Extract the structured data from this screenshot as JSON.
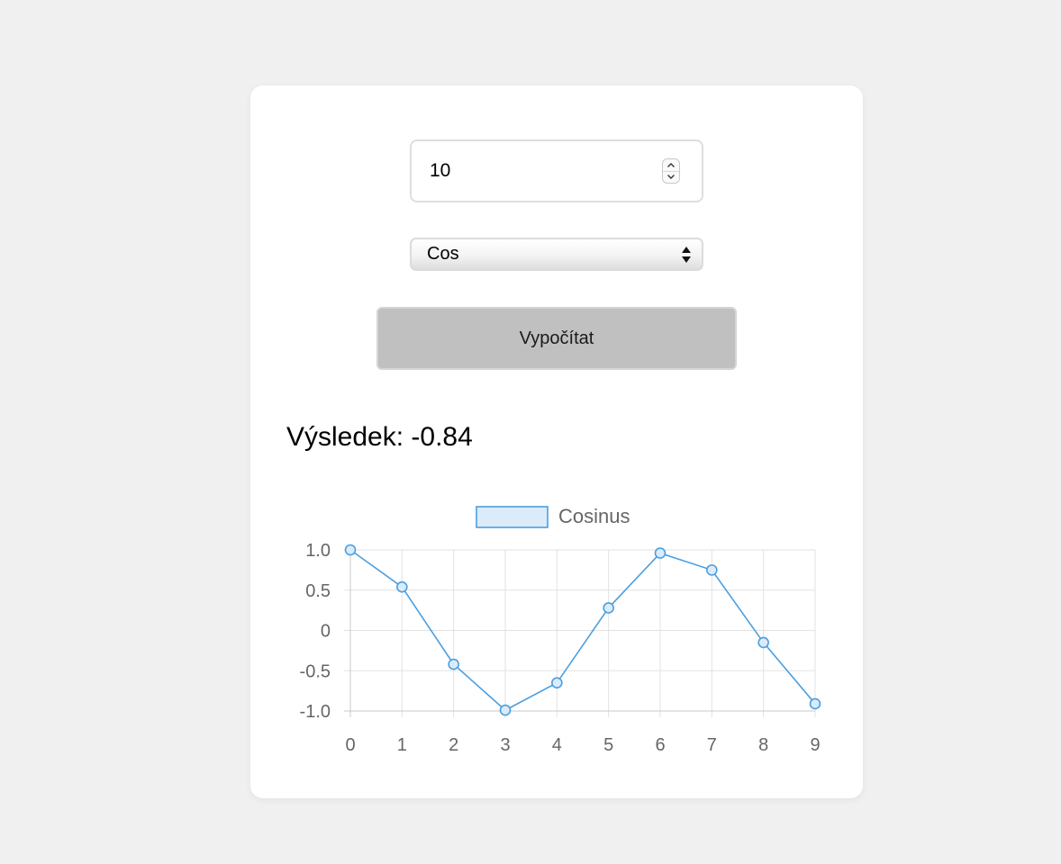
{
  "form": {
    "number_value": "10",
    "function_select": {
      "selected": "Cos"
    },
    "calculate_label": "Vypočítat"
  },
  "result": {
    "text": "Výsledek: -0.84"
  },
  "colors": {
    "page_background": "#f0f0f0",
    "card_background": "#ffffff",
    "button_background": "#c0c0c0",
    "series_line": "#4a9fe0",
    "series_fill": "#dcebf9"
  },
  "chart_data": {
    "type": "line",
    "x": [
      0,
      1,
      2,
      3,
      4,
      5,
      6,
      7,
      8,
      9
    ],
    "series": [
      {
        "name": "Cosinus",
        "values": [
          1.0,
          0.54,
          -0.42,
          -0.99,
          -0.65,
          0.28,
          0.96,
          0.75,
          -0.15,
          -0.91
        ]
      }
    ],
    "ylim": [
      -1.0,
      1.0
    ],
    "yticks": [
      1.0,
      0.5,
      0,
      -0.5,
      -1.0
    ],
    "ytick_labels": [
      "1.0",
      "0.5",
      "0",
      "-0.5",
      "-1.0"
    ],
    "xtick_labels": [
      "0",
      "1",
      "2",
      "3",
      "4",
      "5",
      "6",
      "7",
      "8",
      "9"
    ],
    "grid": true,
    "legend_position": "top"
  }
}
